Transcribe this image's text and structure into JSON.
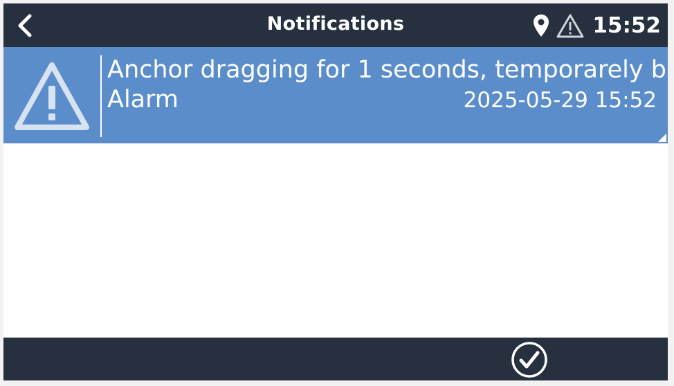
{
  "header": {
    "title": "Notifications",
    "time": "15:52",
    "back_icon": "chevron-left-icon",
    "location_icon": "map-pin-icon",
    "warning_icon": "warning-triangle-icon"
  },
  "notifications": [
    {
      "icon": "warning-triangle-icon",
      "message": "Anchor dragging for 1 seconds, temporarely b",
      "type": "Alarm",
      "datetime": "2025-05-29 15:52"
    }
  ],
  "footer": {
    "acknowledge_icon": "check-circle-icon"
  },
  "colors": {
    "bar": "#26303f",
    "alarm_row": "#5b8dcb",
    "icon_light": "#d8e3f2",
    "background": "#ffffff"
  }
}
